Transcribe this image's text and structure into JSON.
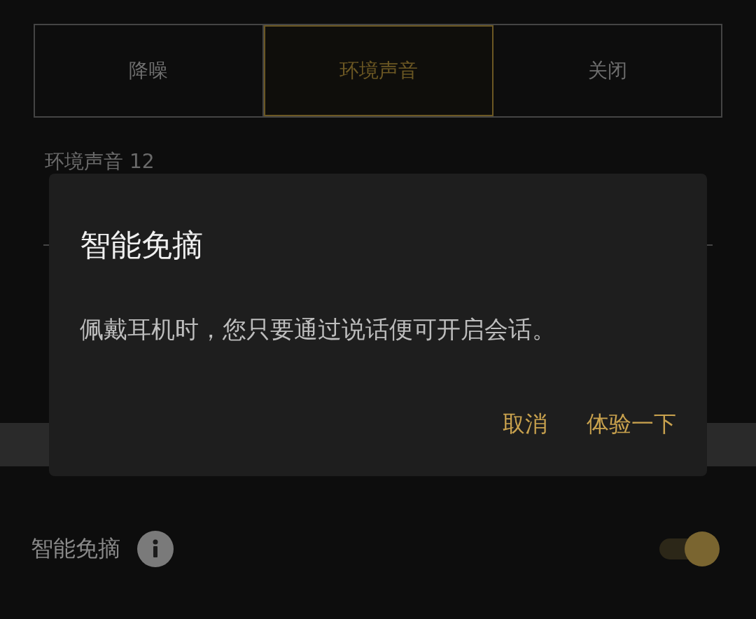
{
  "tabs": [
    {
      "label": "降噪",
      "selected": false
    },
    {
      "label": "环境声音",
      "selected": true
    },
    {
      "label": "关闭",
      "selected": false
    }
  ],
  "ambient_label": "环境声音 12",
  "smart_row": {
    "label": "智能免摘",
    "on": true
  },
  "dialog": {
    "title": "智能免摘",
    "message": "佩戴耳机时，您只要通过说话便可开启会话。",
    "buttons": [
      "取消",
      "体验一下"
    ]
  }
}
